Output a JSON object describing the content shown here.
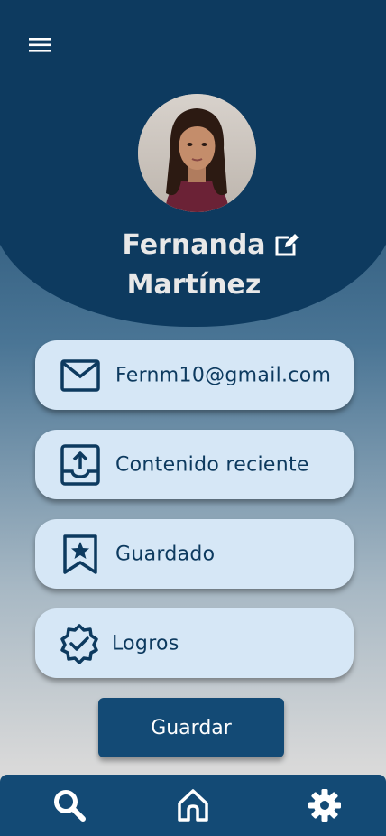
{
  "profile": {
    "first_name": "Fernanda",
    "last_name": "Martínez"
  },
  "menu": [
    {
      "label": "Fernm10@gmail.com",
      "icon": "mail-icon"
    },
    {
      "label": "Contenido reciente",
      "icon": "upload-tray-icon"
    },
    {
      "label": "Guardado",
      "icon": "bookmark-star-icon"
    },
    {
      "label": "Logros",
      "icon": "badge-check-icon"
    }
  ],
  "actions": {
    "save_label": "Guardar"
  },
  "colors": {
    "primary": "#0d3a5f",
    "nav": "#134a75",
    "card": "#d6e7f6"
  },
  "icons": {
    "menu": "hamburger-menu-icon",
    "edit": "edit-icon",
    "nav": [
      "search-icon",
      "home-icon",
      "gear-icon"
    ]
  }
}
